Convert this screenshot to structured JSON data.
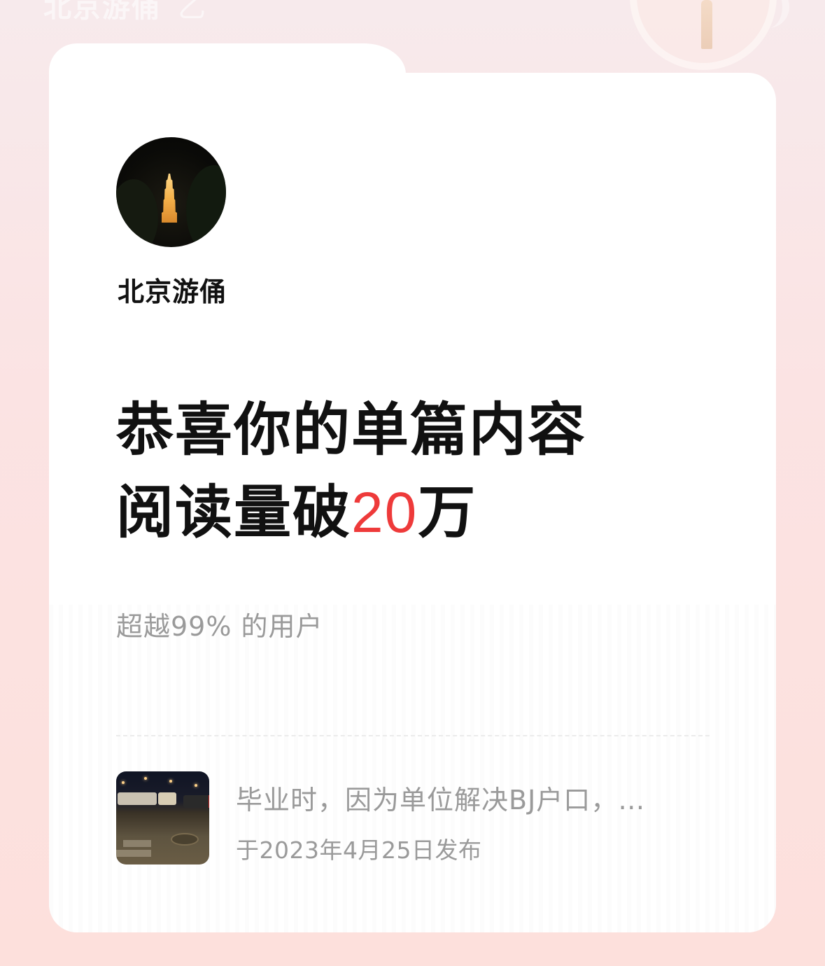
{
  "background": {
    "top_title": "北京游俑",
    "top_mark": "乙"
  },
  "card": {
    "author_name": "北京游俑",
    "headline_line1": "恭喜你的单篇内容",
    "headline_line2_prefix": "阅读量破",
    "headline_number": "20",
    "headline_line2_suffix": "万",
    "beat_text": "超越99% 的用户",
    "article": {
      "title": "毕业时，因为单位解决BJ户口，…",
      "date": "于2023年4月25日发布"
    }
  },
  "colors": {
    "accent_number": "#ee3a3a",
    "text_primary": "#111111",
    "text_secondary": "#9a9a9a",
    "background": "#fbe3e3"
  }
}
